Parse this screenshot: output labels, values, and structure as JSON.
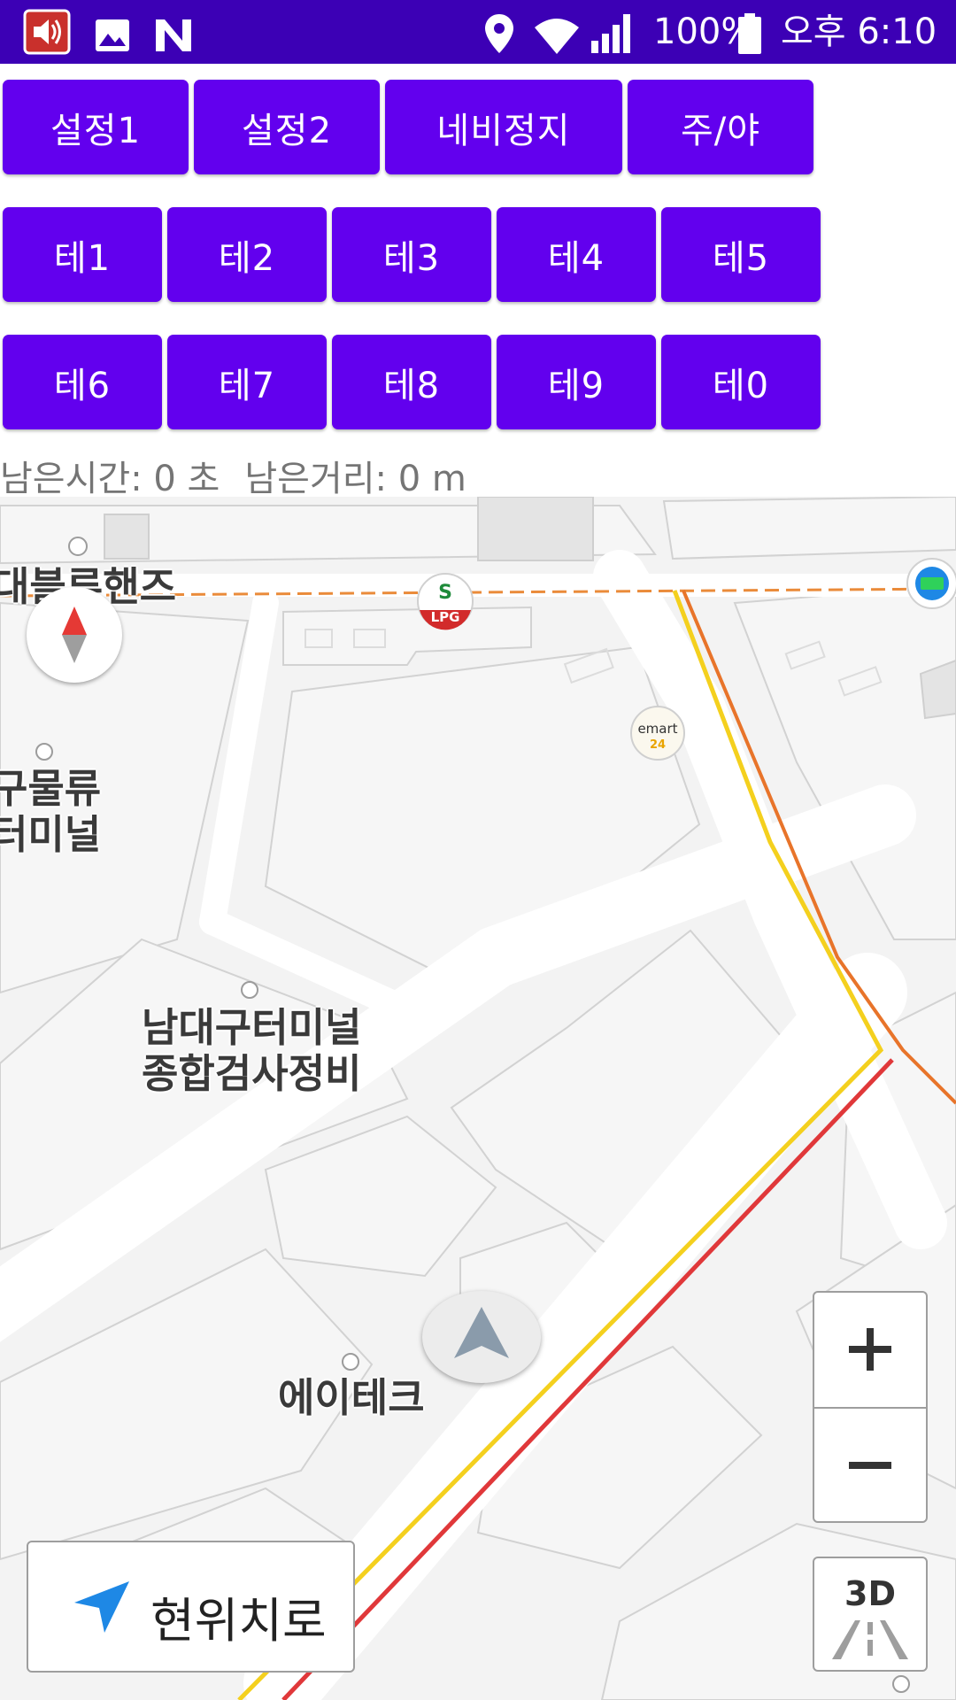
{
  "status_bar": {
    "battery": "100%",
    "time": "오후 6:10",
    "icons": [
      "speaker-icon",
      "image-icon",
      "n-icon",
      "location-icon",
      "wifi-icon",
      "signal-icon",
      "battery-icon"
    ]
  },
  "row1": [
    {
      "label": "설정1"
    },
    {
      "label": "설정2"
    },
    {
      "label": "네비정지"
    },
    {
      "label": "주/야"
    }
  ],
  "row2": [
    {
      "label": "테1"
    },
    {
      "label": "테2"
    },
    {
      "label": "테3"
    },
    {
      "label": "테4"
    },
    {
      "label": "테5"
    }
  ],
  "row3": [
    {
      "label": "테6"
    },
    {
      "label": "테7"
    },
    {
      "label": "테8"
    },
    {
      "label": "테9"
    },
    {
      "label": "테0"
    }
  ],
  "remaining": {
    "time": "남은시간: 0 초",
    "distance": "남은거리: 0 m"
  },
  "map": {
    "labels": {
      "blue_hands": "대블루핸즈",
      "logistics_1": "구물류",
      "logistics_2": "터미널",
      "terminal_1": "남대구터미널",
      "terminal_2": "종합검사정비",
      "atech": "에이테크",
      "lpg_logo": "LPG",
      "emart_logo": "emart",
      "emart_sub": "24"
    },
    "zoom_in": "+",
    "zoom_out": "−",
    "mode_3d": "3D",
    "current_location": "현위치로"
  },
  "colors": {
    "status_bar": "#3c00b5",
    "button": "#6200ee",
    "route_yellow": "#f4d01e",
    "route_red": "#e0383a",
    "route_orange": "#e8742a"
  }
}
